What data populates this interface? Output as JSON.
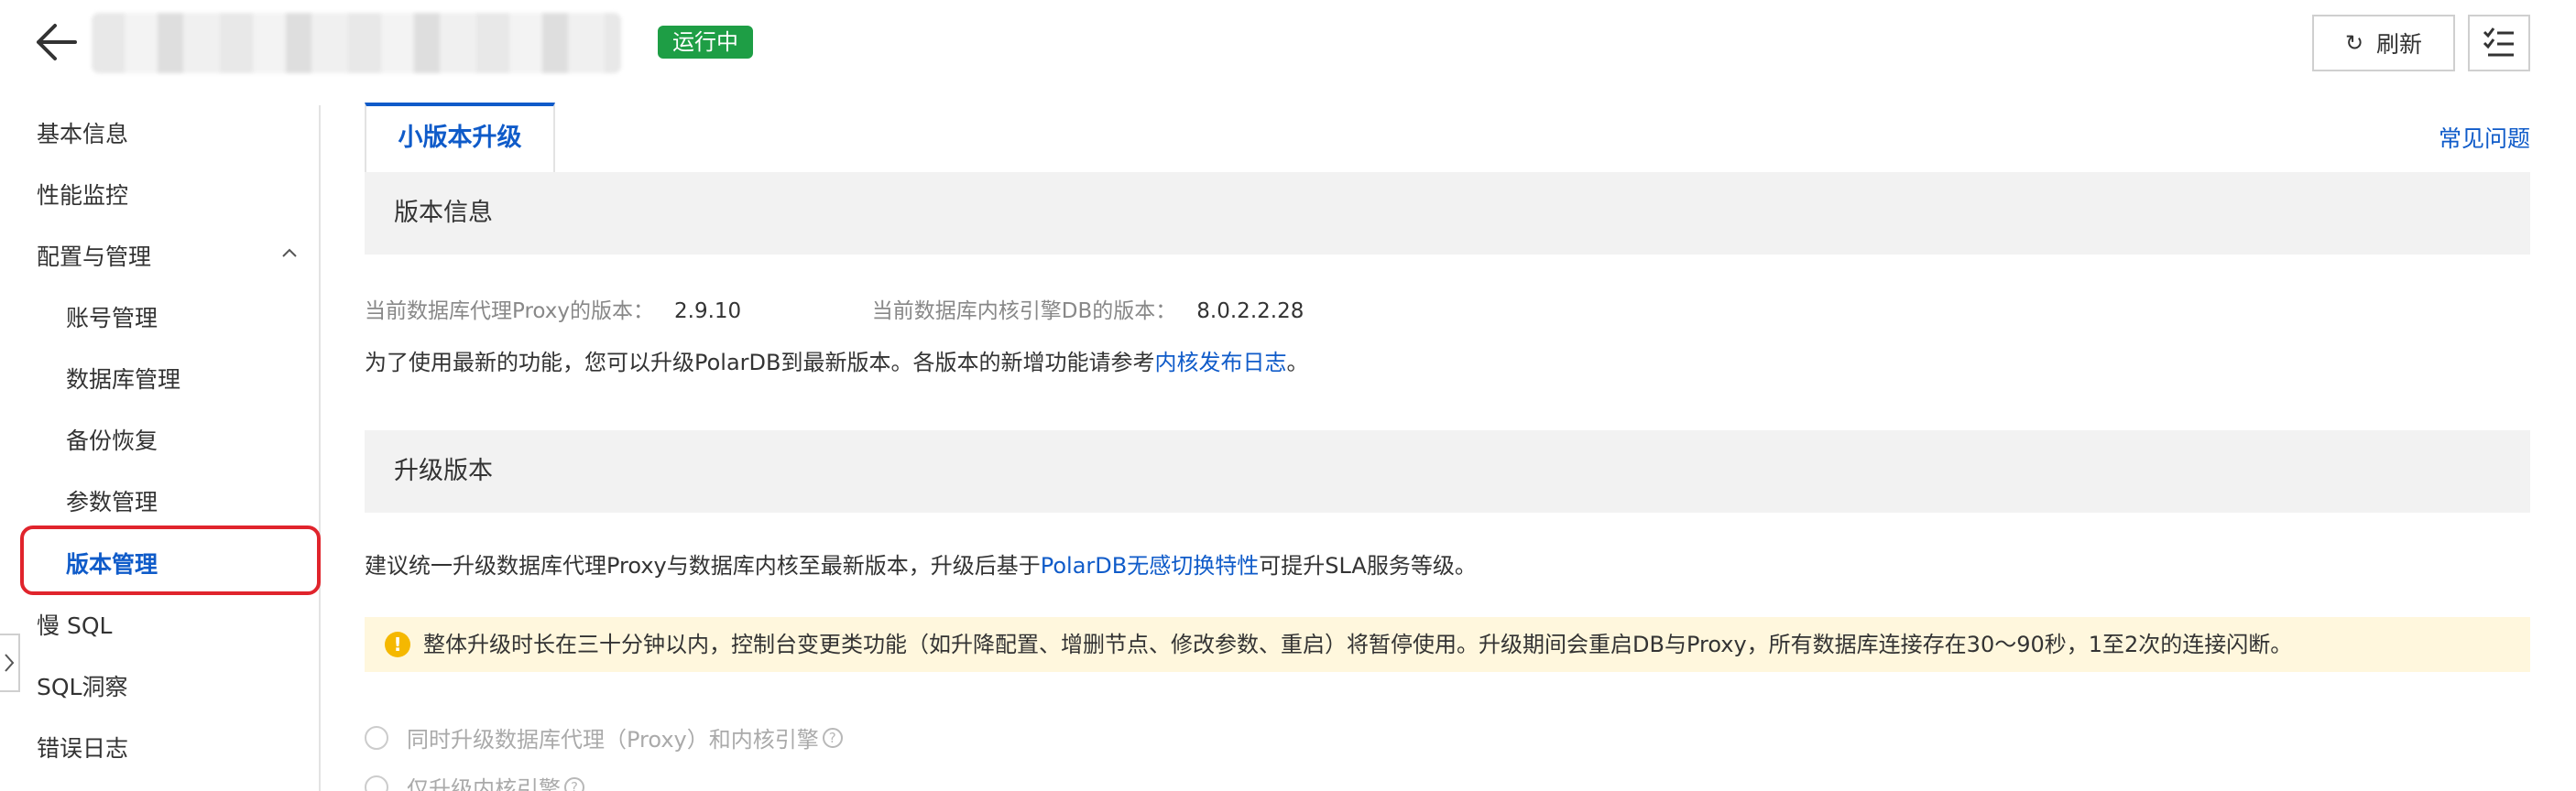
{
  "header": {
    "status_badge": "运行中",
    "refresh_label": "刷新",
    "refresh_icon": "refresh-icon",
    "tasks_icon": "task-list-icon"
  },
  "sidebar": {
    "items": [
      {
        "label": "基本信息"
      },
      {
        "label": "性能监控"
      },
      {
        "label": "配置与管理",
        "expanded": true
      },
      {
        "label": "账号管理"
      },
      {
        "label": "数据库管理"
      },
      {
        "label": "备份恢复"
      },
      {
        "label": "参数管理"
      },
      {
        "label": "版本管理",
        "active": true
      },
      {
        "label": "慢 SQL"
      },
      {
        "label": "SQL洞察"
      },
      {
        "label": "错误日志"
      }
    ]
  },
  "main": {
    "tab_label": "小版本升级",
    "faq_link": "常见问题",
    "version_section": {
      "title": "版本信息",
      "proxy_label": "当前数据库代理Proxy的版本：",
      "proxy_value": "2.9.10",
      "engine_label": "当前数据库内核引擎DB的版本：",
      "engine_value": "8.0.2.2.28",
      "note_prefix": "为了使用最新的功能，您可以升级PolarDB到最新版本。各版本的新增功能请参考",
      "note_link": "内核发布日志",
      "note_suffix": "。"
    },
    "upgrade_section": {
      "title": "升级版本",
      "suggest_prefix": "建议统一升级数据库代理Proxy与数据库内核至最新版本，升级后基于",
      "suggest_link": "PolarDB无感切换特性",
      "suggest_suffix": "可提升SLA服务等级。",
      "warning": "整体升级时长在三十分钟以内，控制台变更类功能（如升降配置、增删节点、修改参数、重启）将暂停使用。升级期间会重启DB与Proxy，所有数据库连接存在30～90秒，1至2次的连接闪断。",
      "options": [
        {
          "label": "同时升级数据库代理（Proxy）和内核引擎"
        },
        {
          "label": "仅升级内核引擎"
        }
      ]
    }
  },
  "colors": {
    "primary": "#0f5bc9",
    "status_green": "#1e9e45",
    "highlight_red": "#e0242c",
    "warning_bg": "#fff7dd",
    "warning_icon": "#f5b800"
  }
}
